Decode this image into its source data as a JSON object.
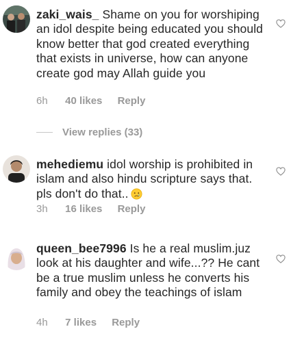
{
  "comments": [
    {
      "username": "zaki_wais_",
      "text": "Shame on you for worshiping an idol despite being educated you should know better that god created everything that exists in universe, how can anyone create god may Allah guide you",
      "time": "6h",
      "likes": "40 likes",
      "reply": "Reply",
      "view_replies": "View replies (33)"
    },
    {
      "username": "mehediemu",
      "text": "idol worship is prohibited in islam and also hindu scripture says that. pls don't do that..",
      "emoji": "crying-face-emoji",
      "time": "3h",
      "likes": "16 likes",
      "reply": "Reply"
    },
    {
      "username": "queen_bee7996",
      "text": "Is he a real muslim.juz look at his daughter and wife...?? He cant be a true muslim unless he converts his family and obey the teachings of islam",
      "time": "4h",
      "likes": "7 likes",
      "reply": "Reply"
    }
  ],
  "icons": {
    "like": "heart-outline-icon"
  },
  "colors": {
    "text": "#262626",
    "meta": "#999999",
    "divider": "#c7c7c7"
  }
}
